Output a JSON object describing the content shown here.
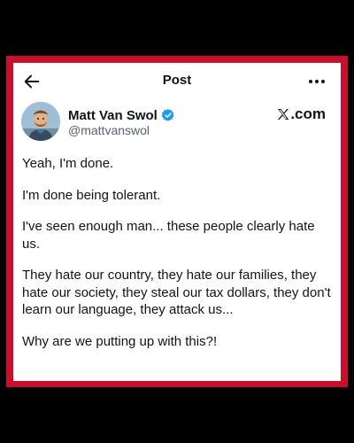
{
  "header": {
    "title": "Post",
    "back_icon": "arrow-left-icon",
    "more_icon": "more-horizontal-icon"
  },
  "author": {
    "name": "Matt Van Swol",
    "handle": "@mattvanswol",
    "verified_icon": "verified-badge-icon",
    "verified_color": "#1d9bf0"
  },
  "brand": {
    "label": ".com",
    "logo": "x-logo"
  },
  "post": {
    "paragraphs": [
      "Yeah, I'm done.",
      "I'm done being tolerant.",
      "I've seen enough man... these people clearly hate us.",
      "They hate our country, they hate our families, they hate our society, they steal our tax dollars, they don't learn our language, they attack us...",
      "Why are we putting up with this?!"
    ]
  },
  "colors": {
    "frame": "#c8102e",
    "background": "#000000",
    "card": "#ffffff",
    "text": "#0f1419",
    "secondary_text": "#536471"
  }
}
